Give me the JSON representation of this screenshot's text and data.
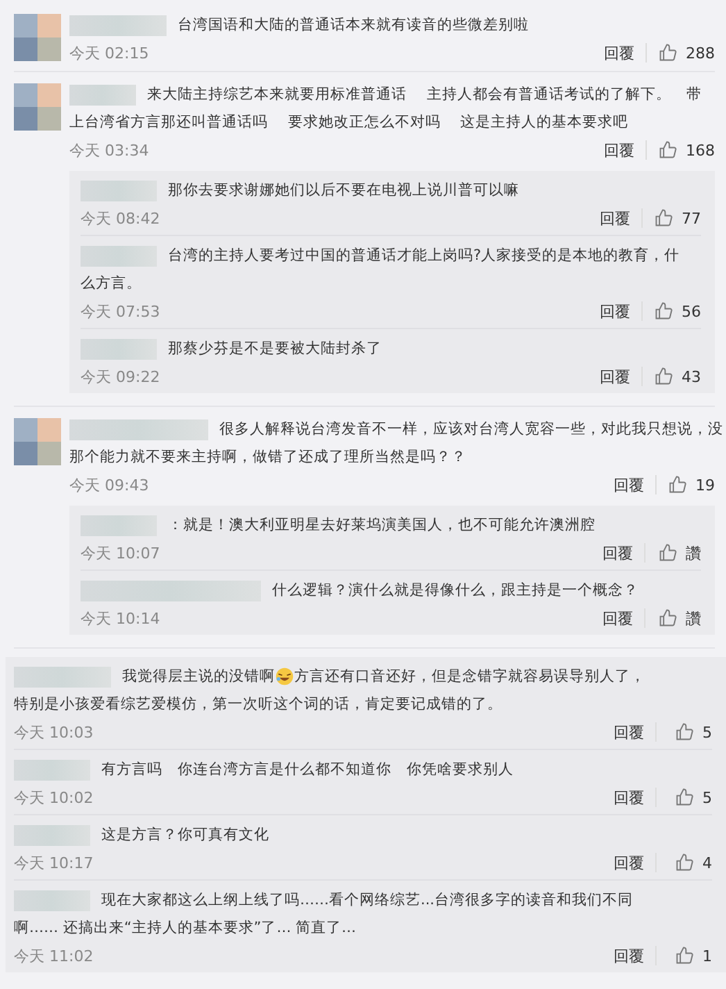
{
  "comments": [
    {
      "avatar": true,
      "lines": [
        [
          {
            "kind": "text",
            "text": "台湾国语和大陆的普通话本来就有读音的些微差别啦"
          }
        ]
      ],
      "time": "今天 02:15",
      "reply": "回覆",
      "likes": "288"
    },
    {
      "avatar": true,
      "lines": [
        [
          {
            "kind": "text",
            "text": "来大陆主持综艺本来就要用标准普通话　 主持人都会有普通话考试的了解下。　带"
          }
        ],
        [
          {
            "kind": "text",
            "text": "上台湾省方言那还叫普通话吗　 要求她改正怎么不对吗　 这是主持人的基本要求吧"
          }
        ]
      ],
      "time": "今天 03:34",
      "reply": "回覆",
      "likes": "168",
      "replies": [
        {
          "lines": [
            [
              {
                "kind": "text",
                "text": "那你去要求谢娜她们以后不要在电视上说川普可以嘛"
              }
            ]
          ],
          "time": "今天 08:42",
          "reply": "回覆",
          "likes": "77"
        },
        {
          "lines": [
            [
              {
                "kind": "text",
                "text": "台湾的主持人要考过中国的普通话才能上岗吗?人家接受的是本地的教育，什"
              }
            ],
            [
              {
                "kind": "text",
                "text": "么方言。"
              }
            ]
          ],
          "time": "今天 07:53",
          "reply": "回覆",
          "likes": "56"
        },
        {
          "lines": [
            [
              {
                "kind": "text",
                "text": "那蔡少芬是不是要被大陆封杀了"
              }
            ]
          ],
          "time": "今天 09:22",
          "reply": "回覆",
          "likes": "43"
        }
      ]
    },
    {
      "avatar": true,
      "lines": [
        [
          {
            "kind": "text",
            "text": "很多人解释说台湾发音不一样，应该对台湾人宽容一些，对此我只想说，没"
          }
        ],
        [
          {
            "kind": "text",
            "text": "那个能力就不要来主持啊，做错了还成了理所当然是吗？？"
          }
        ]
      ],
      "time": "今天 09:43",
      "reply": "回覆",
      "likes": "19",
      "replies": [
        {
          "lines": [
            [
              {
                "kind": "text",
                "text": "：就是！澳大利亚明星去好莱坞演美国人，也不可能允许澳洲腔"
              }
            ]
          ],
          "time": "今天 10:07",
          "reply": "回覆",
          "likes": "讚"
        },
        {
          "lines": [
            [
              {
                "kind": "text",
                "text": "什么逻辑？演什么就是得像什么，跟主持是一个概念？"
              }
            ]
          ],
          "time": "今天 10:14",
          "reply": "回覆",
          "likes": "讚"
        }
      ]
    }
  ],
  "panel_comments": [
    {
      "lines": [
        [
          {
            "kind": "text",
            "text": "我觉得层主说的没错啊"
          },
          {
            "kind": "emoji"
          },
          {
            "kind": "text",
            "text": "方言还有口音还好，但是念错字就容易误导别人了，"
          }
        ],
        [
          {
            "kind": "text",
            "text": "特别是小孩爱看综艺爱模仿，第一次听这个词的话，肯定要记成错的了。"
          }
        ]
      ],
      "time": "今天 10:03",
      "reply": "回覆",
      "likes": "5"
    },
    {
      "lines": [
        [
          {
            "kind": "text",
            "text": "有方言吗　你连台湾方言是什么都不知道你　你凭啥要求别人"
          }
        ]
      ],
      "time": "今天 10:02",
      "reply": "回覆",
      "likes": "5"
    },
    {
      "lines": [
        [
          {
            "kind": "text",
            "text": "这是方言？你可真有文化"
          }
        ]
      ],
      "time": "今天 10:17",
      "reply": "回覆",
      "likes": "4"
    },
    {
      "lines": [
        [
          {
            "kind": "text",
            "text": "现在大家都这么上纲上线了吗……看个网络综艺...台湾很多字的读音和我们不同"
          }
        ],
        [
          {
            "kind": "text",
            "text": "啊…… 还搞出来“主持人的基本要求”了… 简直了…"
          }
        ]
      ],
      "time": "今天 11:02",
      "reply": "回覆",
      "likes": "1"
    }
  ]
}
